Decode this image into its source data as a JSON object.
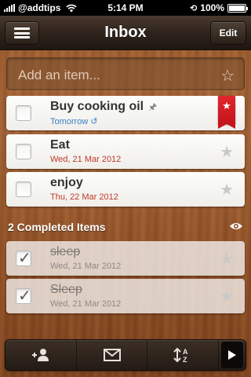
{
  "status_bar": {
    "carrier": "@addtips",
    "time": "5:14 PM",
    "battery": "100%",
    "battery_level": 1.0
  },
  "nav": {
    "title": "Inbox",
    "edit_label": "Edit",
    "menu_icon": "hamburger-menu-icon"
  },
  "add_item": {
    "placeholder": "Add an item...",
    "star_icon": "star-outline-icon"
  },
  "tasks": [
    {
      "title": "Buy cooking oil",
      "due": "Tomorrow",
      "starred": true,
      "due_color": "#3b82c4"
    },
    {
      "title": "Eat",
      "due": "Wed, 21 Mar 2012",
      "starred": false,
      "due_color": "#c0392b"
    },
    {
      "title": "enjoy",
      "due": "Thu, 22 Mar 2012",
      "starred": false,
      "due_color": "#c0392b"
    }
  ],
  "completed": {
    "header": "2 Completed Items",
    "items": [
      {
        "title": "sleep",
        "date": "Wed, 21 Mar 2012"
      },
      {
        "title": "Sleep",
        "date": "Wed, 21 Mar 2012"
      }
    ]
  },
  "toolbar": {
    "icons": [
      "add-person-icon",
      "mail-icon",
      "sort-az-icon",
      "play-icon"
    ]
  },
  "colors": {
    "ribbon": "#e2262d",
    "due_blue": "#3b82c4",
    "due_red": "#c0392b"
  }
}
